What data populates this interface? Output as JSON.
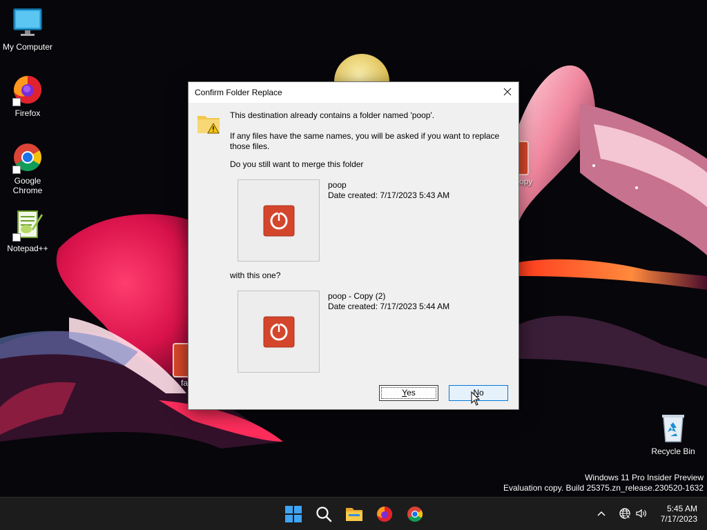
{
  "desktop": {
    "icons": [
      {
        "label": "My Computer"
      },
      {
        "label": "Firefox"
      },
      {
        "label": "Google Chrome"
      },
      {
        "label": "Notepad++"
      },
      {
        "label": "Recycle Bin"
      }
    ],
    "partial_labels": [
      "opy",
      "fa"
    ]
  },
  "watermark": {
    "line1": "Windows 11 Pro Insider Preview",
    "line2": "Evaluation copy. Build 25375.zn_release.230520-1632"
  },
  "dialog": {
    "title": "Confirm Folder Replace",
    "message": "This destination already contains a folder named 'poop'.",
    "detail": "If any files have the same names, you will be asked if you want to replace those files.",
    "question": "Do you still want to merge this folder",
    "with_text": "with this one?",
    "folder1": {
      "name": "poop",
      "date": "Date created: 7/17/2023 5:43 AM"
    },
    "folder2": {
      "name": "poop - Copy (2)",
      "date": "Date created: 7/17/2023 5:44 AM"
    },
    "yes_label": "Yes",
    "no_label": "No"
  },
  "taskbar": {
    "icons": [
      "start-icon",
      "search-icon",
      "file-explorer-icon",
      "firefox-icon",
      "chrome-icon"
    ],
    "tray_icons": [
      "chevron-up-icon",
      "network-icon",
      "volume-icon"
    ]
  },
  "clock": {
    "time": "5:45 AM",
    "date": "7/17/2023"
  },
  "colors": {
    "accent": "#0078d7",
    "power_red": "#d2472b",
    "taskbar": "#1c1c1c"
  }
}
